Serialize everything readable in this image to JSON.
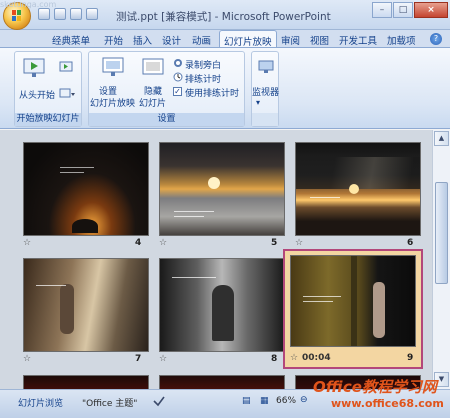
{
  "window": {
    "title": "测试.ppt [兼容模式] - Microsoft PowerPoint",
    "corner_brand": "sketunga.com"
  },
  "tabs": [
    "经典菜单",
    "开始",
    "插入",
    "设计",
    "动画",
    "幻灯片放映",
    "审阅",
    "视图",
    "开发工具",
    "加载项"
  ],
  "active_tab": "幻灯片放映",
  "ribbon": {
    "group_start": {
      "label": "开始放映幻灯片",
      "from_start": "从头开始"
    },
    "group_setup": {
      "label": "设置",
      "setup_show_1": "设置",
      "setup_show_2": "幻灯片放映",
      "hide_1": "隐藏",
      "hide_2": "幻灯片",
      "record_narration": "录制旁白",
      "rehearse_timings": "排练计时",
      "use_timings": "使用排练计时"
    },
    "group_monitor": {
      "monitor": "监视器"
    }
  },
  "slides": [
    {
      "num": "4"
    },
    {
      "num": "5"
    },
    {
      "num": "6"
    },
    {
      "num": "7"
    },
    {
      "num": "8"
    },
    {
      "num": "9",
      "timer": "00:04"
    }
  ],
  "status": {
    "view": "幻灯片浏览",
    "theme": "\"Office 主题\"",
    "zoom": "66%"
  },
  "watermark": {
    "line1": "Office教程学习网",
    "line2": "www.office68.com"
  }
}
